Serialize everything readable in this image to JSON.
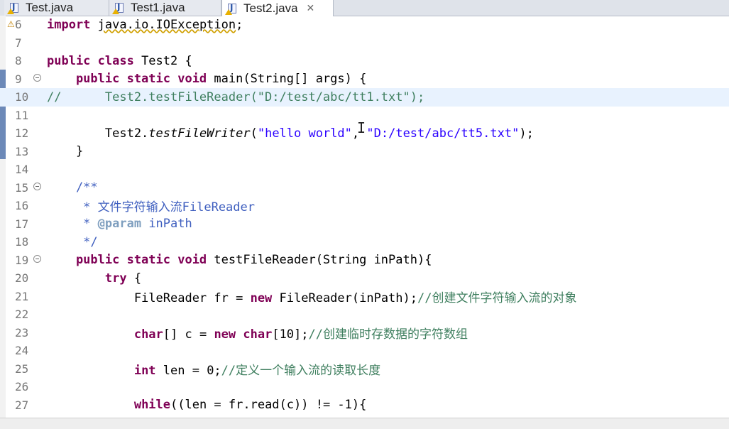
{
  "tabs": [
    {
      "label": "Test.java",
      "active": false
    },
    {
      "label": "Test1.java",
      "active": false
    },
    {
      "label": "Test2.java",
      "active": true
    }
  ],
  "close_glyph": "✕",
  "lines": [
    {
      "n": "6",
      "code": [
        {
          "t": "import ",
          "c": "kw"
        },
        {
          "t": "java.io.IOException",
          "c": "squig"
        },
        {
          "t": ";",
          "c": ""
        }
      ]
    },
    {
      "n": "7",
      "code": []
    },
    {
      "n": "8",
      "code": [
        {
          "t": "public class ",
          "c": "kw"
        },
        {
          "t": "Test2 {",
          "c": ""
        }
      ]
    },
    {
      "n": "9",
      "fold": true,
      "code": [
        {
          "t": "    public static void ",
          "c": "kw"
        },
        {
          "t": "main(String[] args) {",
          "c": ""
        }
      ]
    },
    {
      "n": "10",
      "current": true,
      "code": [
        {
          "t": "//      Test2.testFileReader(\"D:/test/abc/tt1.txt\");",
          "c": "cmt"
        }
      ]
    },
    {
      "n": "11",
      "code": []
    },
    {
      "n": "12",
      "code": [
        {
          "t": "        Test2.",
          "c": ""
        },
        {
          "t": "testFileWriter",
          "c": "it"
        },
        {
          "t": "(",
          "c": ""
        },
        {
          "t": "\"hello world\"",
          "c": "str"
        },
        {
          "t": ", ",
          "c": ""
        },
        {
          "t": "\"D:/test/abc/tt5.txt\"",
          "c": "str"
        },
        {
          "t": ");",
          "c": ""
        }
      ]
    },
    {
      "n": "13",
      "code": [
        {
          "t": "    }",
          "c": ""
        }
      ]
    },
    {
      "n": "14",
      "code": []
    },
    {
      "n": "15",
      "fold": true,
      "code": [
        {
          "t": "    /**",
          "c": "jd"
        }
      ]
    },
    {
      "n": "16",
      "code": [
        {
          "t": "     * 文件字符输入流FileReader",
          "c": "jd"
        }
      ]
    },
    {
      "n": "17",
      "code": [
        {
          "t": "     * ",
          "c": "jd"
        },
        {
          "t": "@param",
          "c": "jdtag"
        },
        {
          "t": " inPath",
          "c": "jd"
        }
      ]
    },
    {
      "n": "18",
      "code": [
        {
          "t": "     */",
          "c": "jd"
        }
      ]
    },
    {
      "n": "19",
      "fold": true,
      "code": [
        {
          "t": "    public static void ",
          "c": "kw"
        },
        {
          "t": "testFileReader(String inPath){",
          "c": ""
        }
      ]
    },
    {
      "n": "20",
      "code": [
        {
          "t": "        try ",
          "c": "kw"
        },
        {
          "t": "{",
          "c": ""
        }
      ]
    },
    {
      "n": "21",
      "code": [
        {
          "t": "            FileReader fr = ",
          "c": ""
        },
        {
          "t": "new ",
          "c": "kw"
        },
        {
          "t": "FileReader(inPath);",
          "c": ""
        },
        {
          "t": "//创建文件字符输入流的对象",
          "c": "cmt"
        }
      ]
    },
    {
      "n": "22",
      "code": []
    },
    {
      "n": "23",
      "code": [
        {
          "t": "            ",
          "c": ""
        },
        {
          "t": "char",
          "c": "kw"
        },
        {
          "t": "[] c = ",
          "c": ""
        },
        {
          "t": "new char",
          "c": "kw"
        },
        {
          "t": "[10];",
          "c": ""
        },
        {
          "t": "//创建临时存数据的字符数组",
          "c": "cmt"
        }
      ]
    },
    {
      "n": "24",
      "code": []
    },
    {
      "n": "25",
      "code": [
        {
          "t": "            ",
          "c": ""
        },
        {
          "t": "int ",
          "c": "kw"
        },
        {
          "t": "len = 0;",
          "c": ""
        },
        {
          "t": "//定义一个输入流的读取长度",
          "c": "cmt"
        }
      ]
    },
    {
      "n": "26",
      "code": []
    },
    {
      "n": "27",
      "code": [
        {
          "t": "            ",
          "c": ""
        },
        {
          "t": "while",
          "c": "kw"
        },
        {
          "t": "((len = fr.read(c)) != -1){",
          "c": ""
        }
      ]
    }
  ]
}
